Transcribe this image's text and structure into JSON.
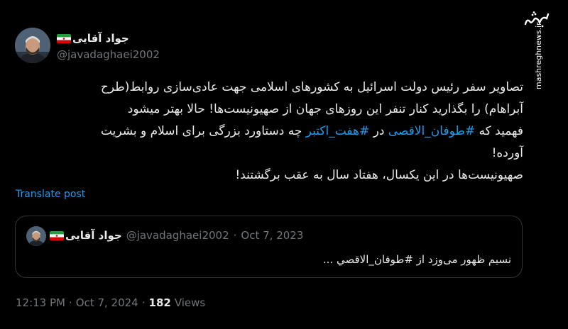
{
  "tweet": {
    "author_name": "جواد آقایی",
    "author_handle": "@javadaghaei2002",
    "flag_icon": "iran-flag-icon",
    "lines": [
      {
        "parts": [
          "تصاویر سفر رئیس دولت اسرائیل به کشورهای اسلامی جهت عادی‌سازی روابط(طرح"
        ]
      },
      {
        "parts": [
          "آبراهام) را بگذارید کنار تنفر این روزهای جهان از صهیونیست‌ها! حالا بهتر میشود"
        ]
      },
      {
        "parts": [
          "فهمید که ",
          "#طوفان_الاقصی",
          " در ",
          "#هفت_اکتبر",
          " چه دستاورد بزرگی برای اسلام و بشریت"
        ]
      },
      {
        "parts": [
          "آورده!"
        ]
      },
      {
        "parts": [
          "صهیونیست‌ها در این یکسال، هفتاد سال به عقب برگشتند!"
        ]
      }
    ],
    "translate_label": "Translate post",
    "time": "12:13 PM",
    "separator": "·",
    "date": "Oct 7, 2024",
    "views_count": "182",
    "views_label": "Views"
  },
  "quote": {
    "author_name": "جواد آقایی",
    "author_handle": "@javadaghaei2002",
    "separator": "·",
    "date": "Oct 7, 2023",
    "text_prefix": "نسیم ظهور می‌وزد از ",
    "text_hashtag": "#طوفان_الاقصي",
    "text_suffix": " ..."
  },
  "watermark": {
    "logo_text": "مشرق",
    "site": "mashreghnews.ir"
  },
  "colors": {
    "background": "#000000",
    "text": "#e7e9ea",
    "secondary": "#71767b",
    "link": "#1d9bf0",
    "border": "#2f3336"
  }
}
